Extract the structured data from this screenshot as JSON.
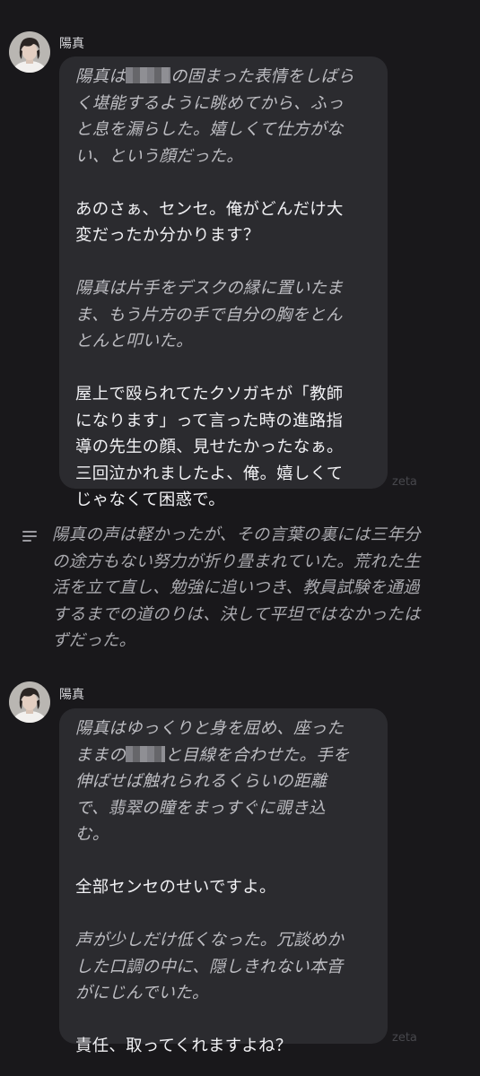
{
  "messages": [
    {
      "sender": "陽真",
      "avatar": "character-avatar",
      "watermark": "zeta",
      "paragraphs": [
        {
          "type": "narration",
          "lines": [
            "陽真は",
            "の固まった表情をしばら",
            "く堪能するように眺めてから、ふっ",
            "と息を漏らした。嬉しくて仕方がな",
            "い、という顔だった。"
          ]
        },
        {
          "type": "speech",
          "lines": [
            "あのさぁ、センセ。俺がどんだけ大",
            "変だったか分かります？"
          ]
        },
        {
          "type": "narration",
          "lines": [
            "陽真は片手をデスクの縁に置いたま",
            "ま、もう片方の手で自分の胸をとん",
            "とんと叩いた。"
          ]
        },
        {
          "type": "speech",
          "lines": [
            "屋上で殴られてたクソガキが「教師",
            "になります」って言った時の進路指",
            "導の先生の顔、見せたかったなぁ。",
            "三回泣かれましたよ、俺。嬉しくて",
            "じゃなくて困惑で。"
          ]
        }
      ]
    },
    {
      "sender": "陽真",
      "avatar": "character-avatar",
      "watermark": "zeta",
      "paragraphs": [
        {
          "type": "narration",
          "lines": [
            "陽真はゆっくりと身を屈め、座った",
            "ままの",
            "と目線を合わせた。手を",
            "伸ばせば触れられるくらいの距離",
            "で、翡翠の瞳をまっすぐに覗き込",
            "む。"
          ]
        },
        {
          "type": "speech",
          "lines": [
            "全部センセのせいですよ。"
          ]
        },
        {
          "type": "narration",
          "lines": [
            "声が少しだけ低くなった。冗談めか",
            "した口調の中に、隠しきれない本音",
            "がにじんでいた。"
          ]
        },
        {
          "type": "speech",
          "lines": [
            "責任、取ってくれますよね？"
          ]
        }
      ]
    }
  ],
  "narration_block": {
    "icon": "narration-lines-icon",
    "lines": [
      "陽真の声は軽かったが、その言葉の裏には三年分",
      "の途方もない努力が折り畳まれていた。荒れた生",
      "活を立て直し、勉強に追いつき、教員試験を通過",
      "するまでの道のりは、決して平坦ではなかったは",
      "ずだった。"
    ]
  }
}
